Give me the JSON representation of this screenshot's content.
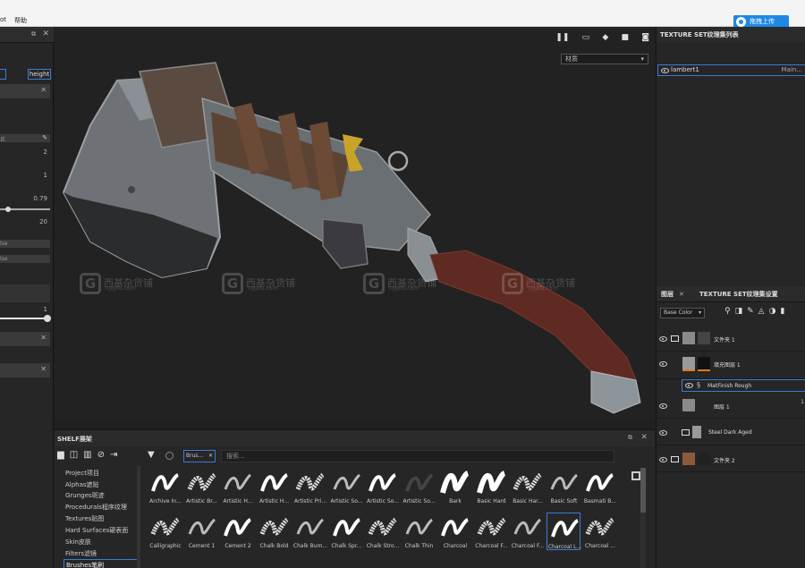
{
  "menubar": {
    "items": [
      "ot",
      "帮助"
    ],
    "upload_label": "拖拽上传"
  },
  "left_panel": {
    "height_tab": "height",
    "values": [
      "2",
      "1",
      "0.79",
      "20",
      "1"
    ],
    "false_labels": [
      "lse",
      "lse"
    ],
    "field_label": "氏"
  },
  "viewport": {
    "dropdown": "材质",
    "watermark": {
      "main": "西基杂货铺",
      "sub": "cggou.com",
      "letter": "G"
    }
  },
  "texture_set_list": {
    "title": "TEXTURE SET纹理集列表",
    "row_name": "lambert1",
    "row_shader": "Main..."
  },
  "layers": {
    "tab_layers": "图层",
    "tab_settings": "TEXTURE SET纹理集设置",
    "blend_mode": "Base Color",
    "items": [
      {
        "name": "文件夹 1",
        "kind": "folder"
      },
      {
        "name": "填充图层 1",
        "kind": "fill"
      },
      {
        "name": "MatFinish Rough",
        "kind": "smart"
      },
      {
        "name": "图层 1",
        "kind": "paint"
      },
      {
        "name": "Steel Dark Aged",
        "kind": "folder"
      },
      {
        "name": "文件夹 2",
        "kind": "folder"
      }
    ],
    "opacity_value": "1"
  },
  "shelf": {
    "title": "SHELF展架",
    "categories": [
      "Project项目",
      "Alphas遮贴",
      "Grunges斑迹",
      "Procedurals程序纹理",
      "Textures贴图",
      "Hard Surfaces硬表面",
      "Skin皮肤",
      "Filters滤镜",
      "Brushes笔刷"
    ],
    "active_category": "Brushes笔刷",
    "filter_chip": "Brus...",
    "search_placeholder": "搜索...",
    "brushes_row1": [
      "Archive In...",
      "Artistic Br...",
      "Artistic H...",
      "Artistic H...",
      "Artistic Pri...",
      "Artistic So...",
      "Artistic So...",
      "Artistic So...",
      "Bark",
      "Basic Hard",
      "Basic Har...",
      "Basic Soft",
      "Basmati B..."
    ],
    "brushes_row2": [
      "Calligraphic",
      "Cement 1",
      "Cement 2",
      "Chalk Bold",
      "Chalk Bum...",
      "Chalk Spr...",
      "Chalk Stro...",
      "Chalk Thin",
      "Charcoal",
      "Charcoal F...",
      "Charcoal F...",
      "Charcoal L...",
      "Charcoal ..."
    ]
  }
}
